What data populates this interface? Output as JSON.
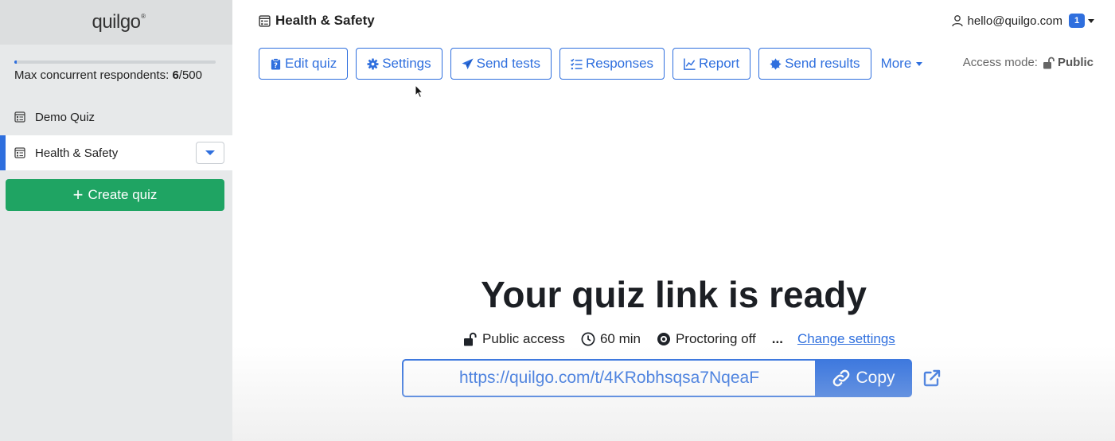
{
  "sidebar": {
    "logo": "quilgo",
    "logo_mark": "®",
    "capacity": {
      "label": "Max concurrent respondents:",
      "current": "6",
      "max": "/500",
      "fraction": 0.012
    },
    "quizzes": [
      {
        "label": "Demo Quiz",
        "active": false,
        "icon": "quiz-icon"
      },
      {
        "label": "Health & Safety",
        "active": true,
        "icon": "quiz-icon"
      }
    ],
    "create_label": "Create quiz"
  },
  "header": {
    "title": "Health & Safety",
    "user_email": "hello@quilgo.com",
    "notification_count": "1"
  },
  "toolbar": {
    "buttons": [
      {
        "label": "Edit quiz",
        "icon": "clipboard-question-icon"
      },
      {
        "label": "Settings",
        "icon": "gear-icon"
      },
      {
        "label": "Send tests",
        "icon": "paper-plane-icon"
      },
      {
        "label": "Responses",
        "icon": "list-check-icon"
      },
      {
        "label": "Report",
        "icon": "line-chart-icon"
      },
      {
        "label": "Send results",
        "icon": "certificate-icon"
      }
    ],
    "more_label": "More",
    "access_label": "Access mode:",
    "access_value": "Public"
  },
  "main": {
    "title": "Your quiz link is ready",
    "meta": {
      "access": "Public access",
      "duration": "60 min",
      "proctoring": "Proctoring off",
      "ellipsis": "...",
      "change_settings": "Change settings"
    },
    "url": "https://quilgo.com/t/4KRobhsqsa7NqeaF",
    "copy_label": "Copy"
  },
  "colors": {
    "accent": "#2f6fde",
    "create": "#1fa463",
    "sidebar_bg": "#e7e9ea"
  }
}
